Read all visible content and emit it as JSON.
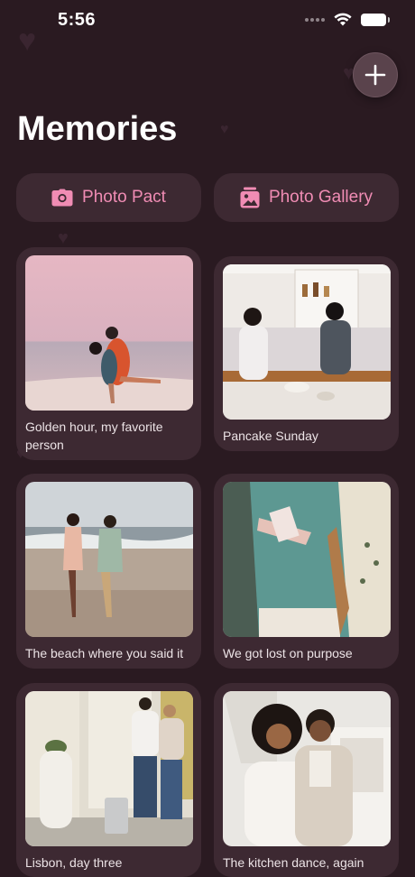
{
  "status_bar": {
    "time": "5:56"
  },
  "header": {
    "title": "Memories",
    "add_icon": "plus-icon"
  },
  "actions": [
    {
      "label": "Photo Pact",
      "icon": "camera-icon"
    },
    {
      "label": "Photo Gallery",
      "icon": "gallery-icon"
    }
  ],
  "memories": [
    {
      "caption": "Golden hour, my favorite person",
      "photo": "couple hugging on beach at dusk"
    },
    {
      "caption": "Pancake Sunday",
      "photo": "couple laughing in kitchen"
    },
    {
      "caption": "The beach where you said it",
      "photo": "couple walking on beach"
    },
    {
      "caption": "We got lost on purpose",
      "photo": "couple holding map"
    },
    {
      "caption": "Lisbon, day three",
      "photo": "couple with suitcase on street"
    },
    {
      "caption": "The kitchen dance, again",
      "photo": "couple dancing in kitchen"
    }
  ],
  "colors": {
    "background": "#2a1a21",
    "card": "#3d2932",
    "accent": "#f08cb4"
  }
}
